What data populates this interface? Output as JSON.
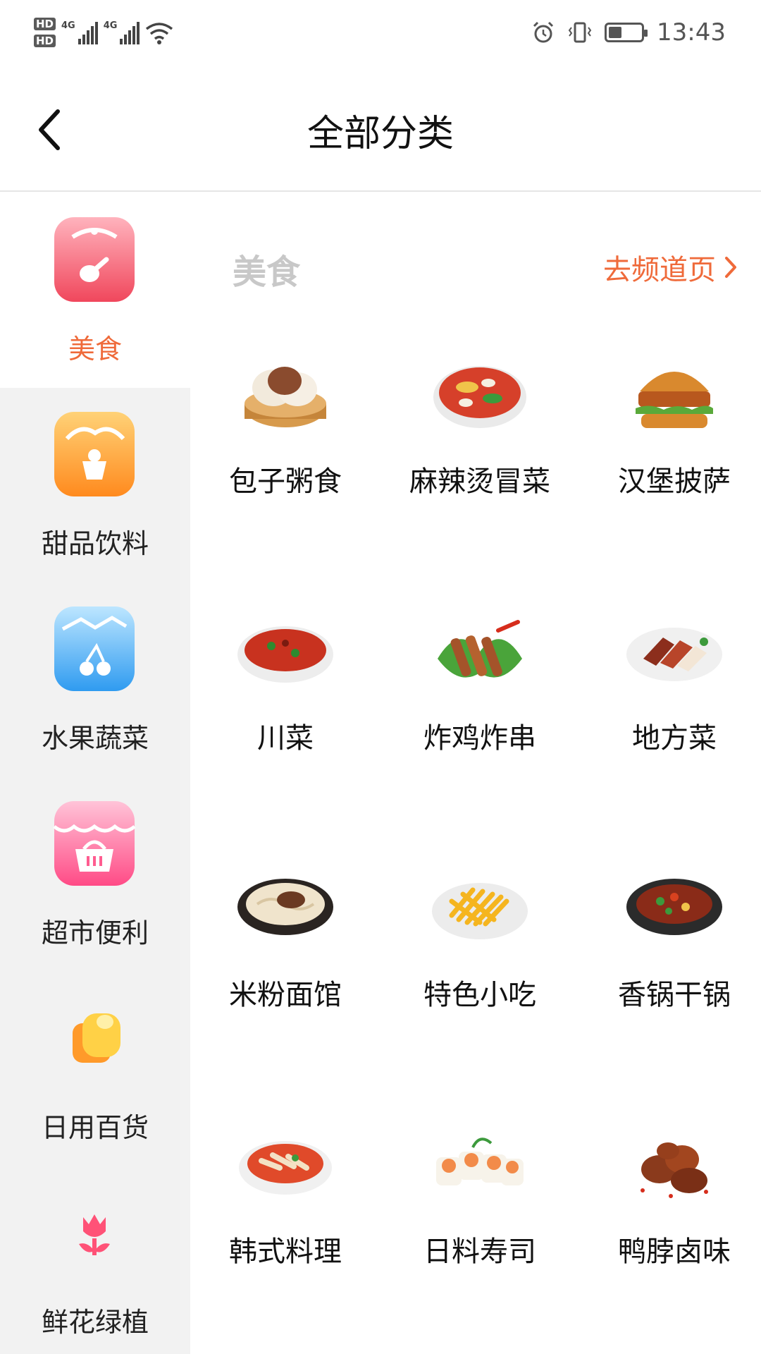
{
  "status_bar": {
    "hd1": "HD",
    "hd2": "HD",
    "net1": "4G",
    "net2": "4G",
    "time": "13:43",
    "battery_level": 0.4
  },
  "header": {
    "title": "全部分类",
    "back_icon": "chevron-left-icon"
  },
  "sidebar": {
    "active_index": 0,
    "items": [
      {
        "label": "美食",
        "icon": "rice-cooker-icon"
      },
      {
        "label": "甜品饮料",
        "icon": "bread-cake-icon"
      },
      {
        "label": "水果蔬菜",
        "icon": "fruit-bag-icon"
      },
      {
        "label": "超市便利",
        "icon": "shop-basket-icon"
      },
      {
        "label": "日用百货",
        "icon": "tissue-roll-icon"
      },
      {
        "label": "鲜花绿植",
        "icon": "tulip-icon"
      }
    ]
  },
  "content": {
    "section_title": "美食",
    "channel_link": "去频道页",
    "items": [
      {
        "label": "包子粥食",
        "image": "steamed-bun-icon"
      },
      {
        "label": "麻辣烫冒菜",
        "image": "spicy-bowl-icon"
      },
      {
        "label": "汉堡披萨",
        "image": "burger-icon"
      },
      {
        "label": "川菜",
        "image": "sichuan-dish-icon"
      },
      {
        "label": "炸鸡炸串",
        "image": "skewers-icon"
      },
      {
        "label": "地方菜",
        "image": "roast-meat-icon"
      },
      {
        "label": "米粉面馆",
        "image": "noodle-bowl-icon"
      },
      {
        "label": "特色小吃",
        "image": "fries-icon"
      },
      {
        "label": "香锅干锅",
        "image": "dry-pot-icon"
      },
      {
        "label": "韩式料理",
        "image": "korean-dish-icon"
      },
      {
        "label": "日料寿司",
        "image": "sushi-icon"
      },
      {
        "label": "鸭脖卤味",
        "image": "braised-duck-icon"
      }
    ]
  },
  "colors": {
    "accent": "#ef6a3a",
    "sidebar_bg": "#f2f2f2",
    "section_title": "#c8c8c8"
  }
}
